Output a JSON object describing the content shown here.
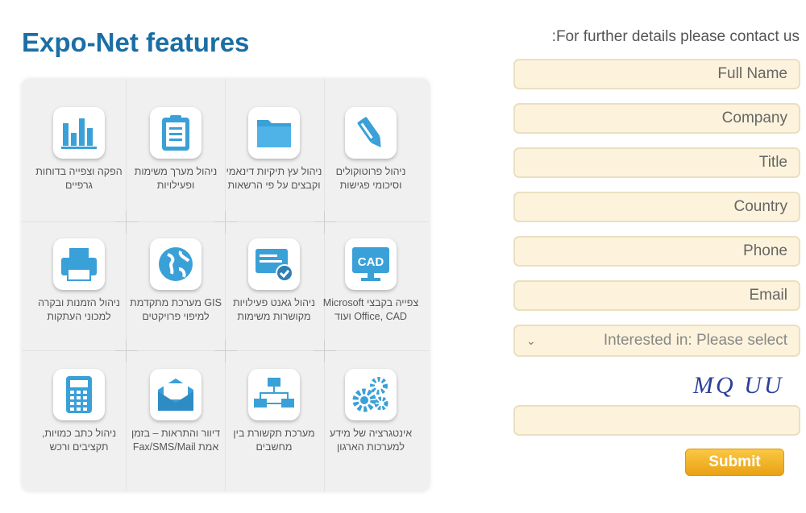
{
  "title": "Expo-Net features",
  "features": [
    {
      "label": "ניהול פרוטוקולים וסיכומי פגישות",
      "icon": "pencil-icon"
    },
    {
      "label": "ניהול עץ תיקיות דינאמי וקבצים על פי הרשאות",
      "icon": "folder-icon"
    },
    {
      "label": "ניהול מערך משימות ופעילויות",
      "icon": "clipboard-icon"
    },
    {
      "label": "הפקה וצפייה בדוחות גרפיים",
      "icon": "bar-chart-icon"
    },
    {
      "label": "צפייה בקבצי Microsoft Office, CAD ועוד",
      "icon": "cad-monitor-icon",
      "badge": "CAD"
    },
    {
      "label": "ניהול גאנט פעילויות מקושרות משימות",
      "icon": "gantt-check-icon"
    },
    {
      "label": "GIS מערכת מתקדמת למיפוי פרויקטים",
      "icon": "globe-icon"
    },
    {
      "label": "ניהול הזמנות ובקרה למכוני העתקות",
      "icon": "printer-icon"
    },
    {
      "label": "אינטגרציה של מידע למערכות הארגון",
      "icon": "gears-icon"
    },
    {
      "label": "מערכת תקשורת בין מחשבים",
      "icon": "network-icon"
    },
    {
      "label": "דיוור והתראות – בזמן אמת Fax/SMS/Mail",
      "icon": "envelope-icon"
    },
    {
      "label": "ניהול כתב כמויות, תקציבים ורכש",
      "icon": "calculator-icon"
    }
  ],
  "form": {
    "heading": ":For further details please contact us",
    "fields": [
      "Full Name",
      "Company",
      "Title",
      "Country",
      "Phone",
      "Email"
    ],
    "select": "Interested in: Please select",
    "captcha": "MQ UU",
    "submit": "Submit"
  },
  "colors": {
    "accent": "#1c6ea4",
    "icon": "#3aa0d8",
    "field_bg": "#fdf3dc",
    "submit": "#f0ae20"
  }
}
